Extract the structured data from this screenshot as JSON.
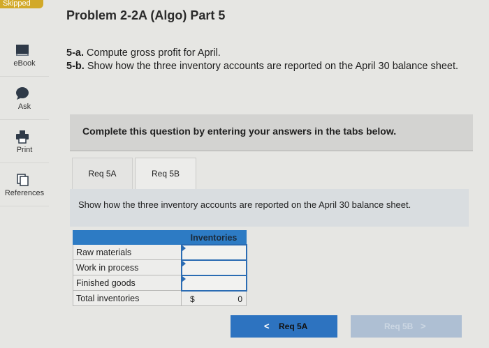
{
  "badge": "Skipped",
  "sidebar": {
    "items": [
      {
        "label": "eBook",
        "icon": "book-icon"
      },
      {
        "label": "Ask",
        "icon": "chat-bubble-icon"
      },
      {
        "label": "Print",
        "icon": "printer-icon"
      },
      {
        "label": "References",
        "icon": "documents-icon"
      }
    ]
  },
  "problem": {
    "title": "Problem 2-2A (Algo) Part 5",
    "part_a_label": "5-a.",
    "part_a_text": "Compute gross profit for April.",
    "part_b_label": "5-b.",
    "part_b_text": "Show how the three inventory accounts are reported on the April 30 balance sheet."
  },
  "banner": "Complete this question by entering your answers in the tabs below.",
  "tabs": [
    {
      "label": "Req 5A",
      "active": false
    },
    {
      "label": "Req 5B",
      "active": true
    }
  ],
  "instruction": "Show how the three inventory accounts are reported on the April 30 balance sheet.",
  "table": {
    "header": "Inventories",
    "rows": [
      {
        "label": "Raw materials",
        "value": ""
      },
      {
        "label": "Work in process",
        "value": ""
      },
      {
        "label": "Finished goods",
        "value": ""
      }
    ],
    "total": {
      "label": "Total inventories",
      "currency": "$",
      "value": "0"
    }
  },
  "nav": {
    "prev_label": "Req 5A",
    "next_label": "Req 5B",
    "prev_chevron": "<",
    "next_chevron": ">"
  },
  "colors": {
    "accent": "#2d73c0",
    "badge": "#d2a928",
    "disabled": "#aebfd3"
  }
}
